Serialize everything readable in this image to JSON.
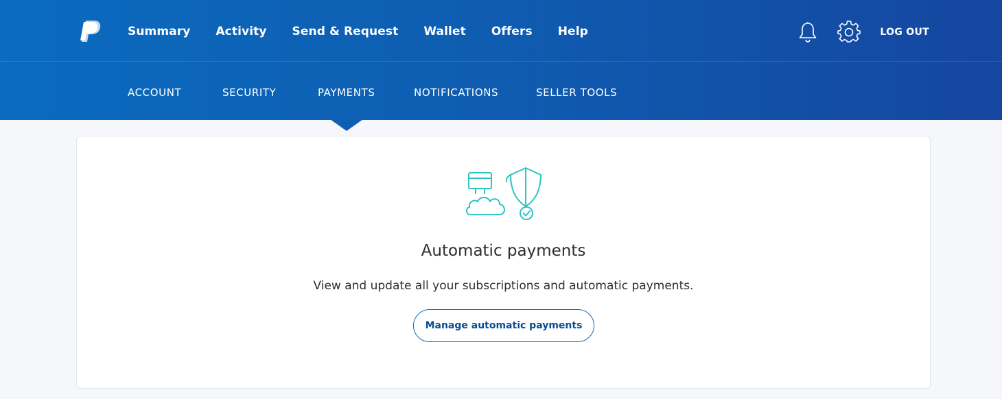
{
  "header": {
    "primary_nav": [
      {
        "label": "Summary"
      },
      {
        "label": "Activity"
      },
      {
        "label": "Send & Request"
      },
      {
        "label": "Wallet"
      },
      {
        "label": "Offers"
      },
      {
        "label": "Help"
      }
    ],
    "icons": {
      "logo": "paypal-logo",
      "notifications": "bell-icon",
      "settings": "gear-icon"
    },
    "logout_label": "LOG OUT"
  },
  "subnav": {
    "items": [
      {
        "label": "ACCOUNT"
      },
      {
        "label": "SECURITY"
      },
      {
        "label": "PAYMENTS"
      },
      {
        "label": "NOTIFICATIONS"
      },
      {
        "label": "SELLER TOOLS"
      }
    ],
    "active": "PAYMENTS"
  },
  "card": {
    "icon": "automatic-payments-illustration",
    "title": "Automatic payments",
    "description": "View and update all your subscriptions and automatic payments.",
    "button_label": "Manage automatic payments"
  },
  "colors": {
    "header_start": "#0a6bbf",
    "header_end": "#1546a0",
    "accent_teal": "#2ec4c1",
    "button_text": "#0a4e96",
    "page_bg": "#f5f7fa"
  }
}
